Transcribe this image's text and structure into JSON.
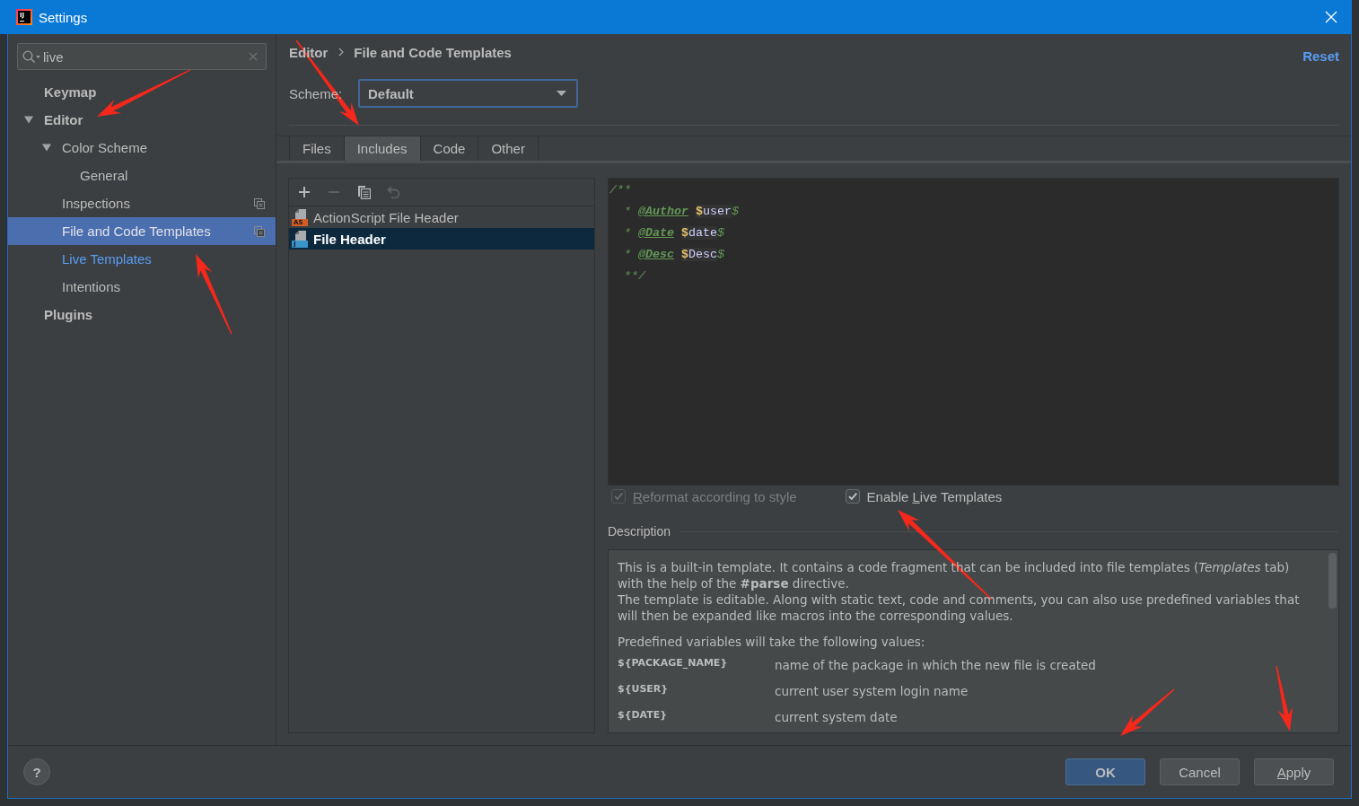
{
  "window": {
    "title": "Settings",
    "icon_text": "IJ"
  },
  "sidebar": {
    "search": {
      "value": "live"
    },
    "tree": [
      {
        "label": "Keymap",
        "selected": false,
        "highlighted": false,
        "project_level": false
      },
      {
        "label": "Editor",
        "selected": false,
        "highlighted": false,
        "project_level": false,
        "expanded": true,
        "children": [
          {
            "label": "Color Scheme",
            "selected": false,
            "highlighted": false,
            "project_level": false,
            "expanded": true,
            "children": [
              {
                "label": "General",
                "selected": false,
                "highlighted": false,
                "project_level": false
              }
            ]
          },
          {
            "label": "Inspections",
            "selected": false,
            "highlighted": false,
            "project_level": true
          },
          {
            "label": "File and Code Templates",
            "selected": true,
            "highlighted": false,
            "project_level": true
          },
          {
            "label": "Live Templates",
            "selected": false,
            "highlighted": true,
            "project_level": false
          },
          {
            "label": "Intentions",
            "selected": false,
            "highlighted": false,
            "project_level": false
          }
        ]
      },
      {
        "label": "Plugins",
        "selected": false,
        "highlighted": false,
        "project_level": false
      }
    ]
  },
  "header": {
    "breadcrumb": [
      "Editor",
      "File and Code Templates"
    ],
    "reset": "Reset"
  },
  "scheme": {
    "label": "Scheme:",
    "value": "Default",
    "focused": true
  },
  "tabs": [
    {
      "label": "Files",
      "selected": false
    },
    {
      "label": "Includes",
      "selected": true
    },
    {
      "label": "Code",
      "selected": false
    },
    {
      "label": "Other",
      "selected": false
    }
  ],
  "template_list": {
    "toolbar": [
      {
        "kind": "add",
        "disabled": false
      },
      {
        "kind": "remove",
        "disabled": true
      },
      {
        "kind": "copy",
        "disabled": false
      },
      {
        "kind": "reset",
        "disabled": true
      }
    ],
    "items": [
      {
        "name": "ActionScript File Header",
        "kind": "actionscript",
        "badge": "AS",
        "selected": false
      },
      {
        "name": "File Header",
        "kind": "java",
        "badge": "J",
        "selected": true
      }
    ]
  },
  "editor": {
    "lines": [
      {
        "segments": [
          {
            "kind": "comment",
            "text": "/**"
          }
        ]
      },
      {
        "segments": [
          {
            "kind": "comment",
            "text": "  * "
          },
          {
            "kind": "tag",
            "text": "@Author"
          },
          {
            "kind": "dollar",
            "text": "$"
          },
          {
            "kind": "variable",
            "text": "user"
          },
          {
            "kind": "comment",
            "text": "$"
          }
        ]
      },
      {
        "segments": [
          {
            "kind": "comment",
            "text": "  * "
          },
          {
            "kind": "tag",
            "text": "@Date"
          },
          {
            "kind": "dollar",
            "text": "$"
          },
          {
            "kind": "variable",
            "text": "date"
          },
          {
            "kind": "comment",
            "text": "$"
          }
        ]
      },
      {
        "segments": [
          {
            "kind": "comment",
            "text": "  * "
          },
          {
            "kind": "tag",
            "text": "@Desc"
          },
          {
            "kind": "dollar",
            "text": "$"
          },
          {
            "kind": "variable",
            "text": "Desc"
          },
          {
            "kind": "comment",
            "text": "$"
          }
        ]
      },
      {
        "segments": [
          {
            "kind": "comment",
            "text": "  **/"
          }
        ]
      }
    ]
  },
  "options": [
    {
      "label_parts": [
        {
          "text": "R",
          "underlined": true
        },
        {
          "text": "eformat according to style",
          "underlined": false
        }
      ],
      "checked": true,
      "disabled": true
    },
    {
      "label_parts": [
        {
          "text": "Enable ",
          "underlined": false
        },
        {
          "text": "L",
          "underlined": true
        },
        {
          "text": "ive Templates",
          "underlined": false
        }
      ],
      "checked": true,
      "disabled": false
    }
  ],
  "description": {
    "title": "Description",
    "paragraphs": [
      "This is a built-in template. It contains a code fragment that can be included into file templates (*Templates* tab) with the help of the **#parse** directive.",
      "The template is editable. Along with static text, code and comments, you can also use predefined variables that will then be expanded like macros into the corresponding values."
    ],
    "intro": "Predefined variables will take the following values:",
    "variables": [
      {
        "name": "${PACKAGE_NAME}",
        "meaning": "name of the package in which the new file is created"
      },
      {
        "name": "${USER}",
        "meaning": "current user system login name"
      },
      {
        "name": "${DATE}",
        "meaning": "current system date"
      }
    ]
  },
  "footer": {
    "help": "?",
    "buttons": [
      {
        "label_parts": [
          {
            "text": "OK",
            "underlined": false
          }
        ],
        "kind": "default"
      },
      {
        "label_parts": [
          {
            "text": "Cancel",
            "underlined": false
          }
        ],
        "kind": "normal"
      },
      {
        "label_parts": [
          {
            "text": "A",
            "underlined": true
          },
          {
            "text": "pply",
            "underlined": false
          }
        ],
        "kind": "normal"
      }
    ]
  },
  "annotations": [
    {
      "kind": "arrow"
    },
    {
      "kind": "arrow"
    },
    {
      "kind": "arrow"
    },
    {
      "kind": "arrow"
    },
    {
      "kind": "arrow"
    },
    {
      "kind": "arrow"
    }
  ]
}
